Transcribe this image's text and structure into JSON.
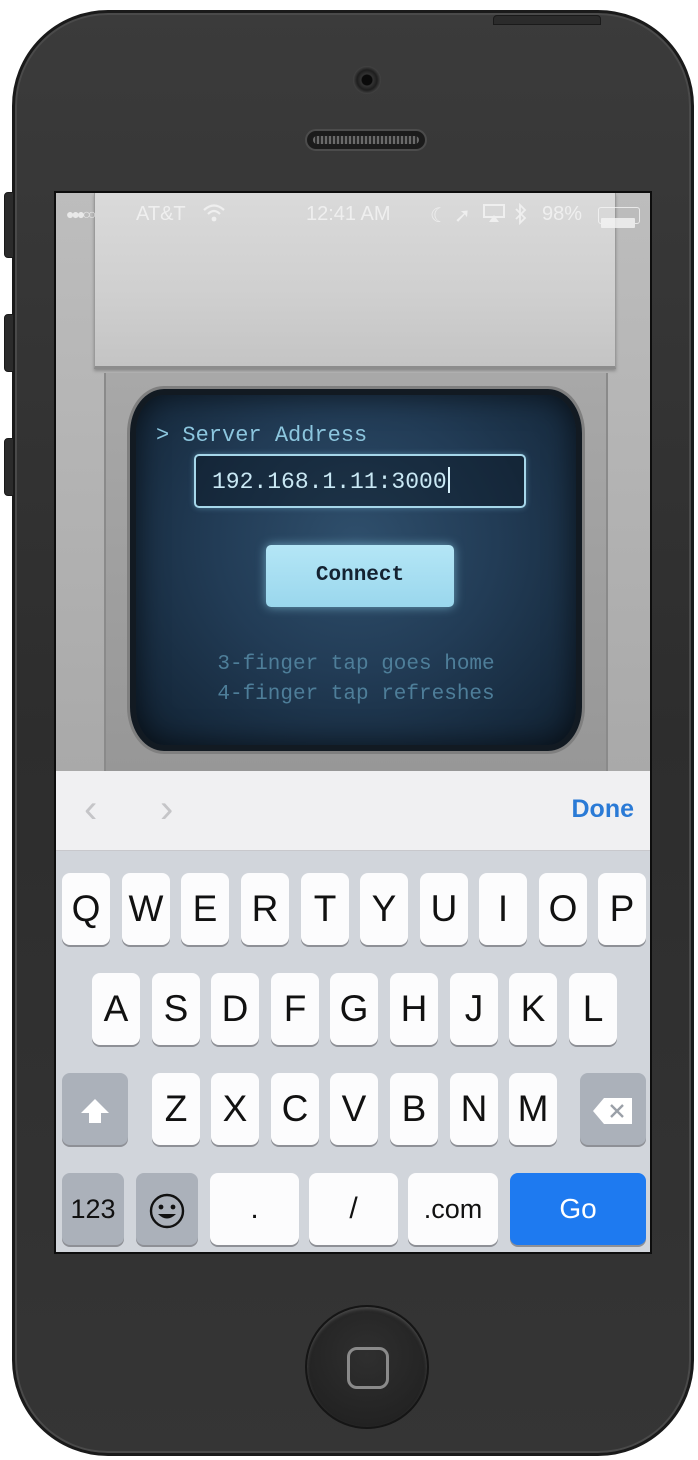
{
  "status_bar": {
    "signal": "●●●○○",
    "carrier": "AT&T",
    "time": "12:41 AM",
    "battery": "98%",
    "icons": [
      "wifi-icon",
      "moon-icon",
      "location-arrow-icon",
      "airplay-icon",
      "bluetooth-icon",
      "battery-icon"
    ]
  },
  "app": {
    "prompt_label": "> Server Address",
    "server_address_value": "192.168.1.11:3000",
    "connect_label": "Connect",
    "hint_line_1": "3-finger tap goes home",
    "hint_line_2": "4-finger tap refreshes"
  },
  "accessory_bar": {
    "prev_label": "‹",
    "next_label": "›",
    "done_label": "Done"
  },
  "keyboard": {
    "row1": [
      "Q",
      "W",
      "E",
      "R",
      "T",
      "Y",
      "U",
      "I",
      "O",
      "P"
    ],
    "row2": [
      "A",
      "S",
      "D",
      "F",
      "G",
      "H",
      "J",
      "K",
      "L"
    ],
    "row3": [
      "Z",
      "X",
      "C",
      "V",
      "B",
      "N",
      "M"
    ],
    "numbers_label": "123",
    "period_label": ".",
    "slash_label": "/",
    "dotcom_label": ".com",
    "go_label": "Go"
  },
  "colors": {
    "go_key": "#1e7af0",
    "done_text": "#2a7ad6",
    "crt_text": "#8cc6de",
    "connect_button": "#9ad7ed"
  }
}
